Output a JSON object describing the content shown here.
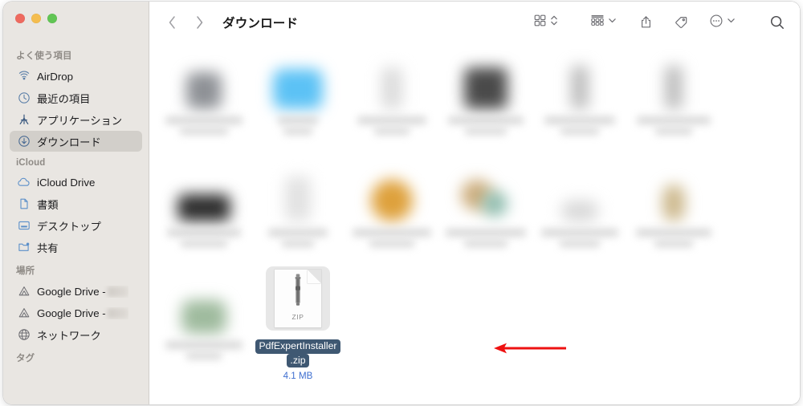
{
  "window": {
    "traffic_lights": [
      {
        "name": "close",
        "color": "#ee6a5f"
      },
      {
        "name": "minimize",
        "color": "#f4bd4f"
      },
      {
        "name": "zoom",
        "color": "#61c554"
      }
    ]
  },
  "toolbar": {
    "back_icon": "chevron-left-icon",
    "forward_icon": "chevron-right-icon",
    "title": "ダウンロード",
    "view_icon": "grid-view-icon",
    "view_stepper_icon": "chevron-up-down-icon",
    "group_icon": "group-by-icon",
    "group_chevron_icon": "chevron-down-icon",
    "share_icon": "share-icon",
    "tag_icon": "tag-icon",
    "more_icon": "ellipsis-circle-icon",
    "more_chevron_icon": "chevron-down-icon",
    "search_icon": "search-icon"
  },
  "sidebar": {
    "groups": [
      {
        "title": "よく使う項目",
        "items": [
          {
            "label": "AirDrop",
            "icon": "airdrop-icon",
            "selected": false
          },
          {
            "label": "最近の項目",
            "icon": "clock-icon",
            "selected": false
          },
          {
            "label": "アプリケーション",
            "icon": "applications-icon",
            "selected": false
          },
          {
            "label": "ダウンロード",
            "icon": "downloads-icon",
            "selected": true
          }
        ]
      },
      {
        "title": "iCloud",
        "items": [
          {
            "label": "iCloud Drive",
            "icon": "cloud-icon",
            "selected": false
          },
          {
            "label": "書類",
            "icon": "document-icon",
            "selected": false
          },
          {
            "label": "デスクトップ",
            "icon": "desktop-icon",
            "selected": false
          },
          {
            "label": "共有",
            "icon": "shared-folder-icon",
            "selected": false
          }
        ]
      },
      {
        "title": "場所",
        "items": [
          {
            "label": "Google Drive -",
            "icon": "google-drive-icon",
            "selected": false,
            "blurred_tail": true
          },
          {
            "label": "Google Drive -",
            "icon": "google-drive-icon",
            "selected": false,
            "blurred_tail": true
          },
          {
            "label": "ネットワーク",
            "icon": "network-globe-icon",
            "selected": false
          }
        ]
      },
      {
        "title": "タグ",
        "items": []
      }
    ]
  },
  "files": {
    "rows": [
      {
        "items": [
          {
            "blurred": true,
            "color": "#8e9196",
            "w": 44,
            "h": 46,
            "r": 10
          },
          {
            "blurred": true,
            "color": "#5cc2f5",
            "w": 62,
            "h": 50,
            "r": 12
          },
          {
            "blurred": true,
            "color": "#dcdcdc",
            "w": 26,
            "h": 52,
            "r": 8
          },
          {
            "blurred": true,
            "color": "#4a4a4a",
            "w": 54,
            "h": 52,
            "r": 8
          },
          {
            "blurred": true,
            "color": "#bdbdbd",
            "w": 22,
            "h": 54,
            "r": 6
          },
          {
            "blurred": true,
            "color": "#bdbdbd",
            "w": 22,
            "h": 54,
            "r": 6
          }
        ]
      },
      {
        "items": [
          {
            "blurred": true,
            "color": "#2e2e2e",
            "w": 66,
            "h": 34,
            "r": 9
          },
          {
            "blurred": true,
            "color": "#e2e2e2",
            "w": 32,
            "h": 56,
            "r": 8
          },
          {
            "blurred": true,
            "color": "#dea13c",
            "w": 52,
            "h": 52,
            "r": 26
          },
          {
            "blurred": true,
            "color": "#cdae7e",
            "w": 44,
            "h": 40,
            "r": 20
          },
          {
            "blurred": true,
            "color": "#d9d9d9",
            "w": 46,
            "h": 26,
            "r": 12
          },
          {
            "blurred": true,
            "color": "#cdb98e",
            "w": 28,
            "h": 46,
            "r": 14
          }
        ]
      },
      {
        "items": [
          {
            "blurred": true,
            "color": "#9fbb9e",
            "w": 56,
            "h": 42,
            "r": 12
          },
          {
            "zip": true
          }
        ]
      }
    ],
    "selected_file": {
      "name_line1": "PdfExpertInstaller",
      "name_line2": ".zip",
      "size": "4.1 MB",
      "type_label": "ZIP",
      "icon": "zip-archive-icon",
      "highlight_color": "#3f5872",
      "size_color": "#3f6fd0"
    }
  },
  "annotation": {
    "arrow": {
      "name": "red-pointer-arrow",
      "color": "#ee1111",
      "direction": "left"
    }
  }
}
